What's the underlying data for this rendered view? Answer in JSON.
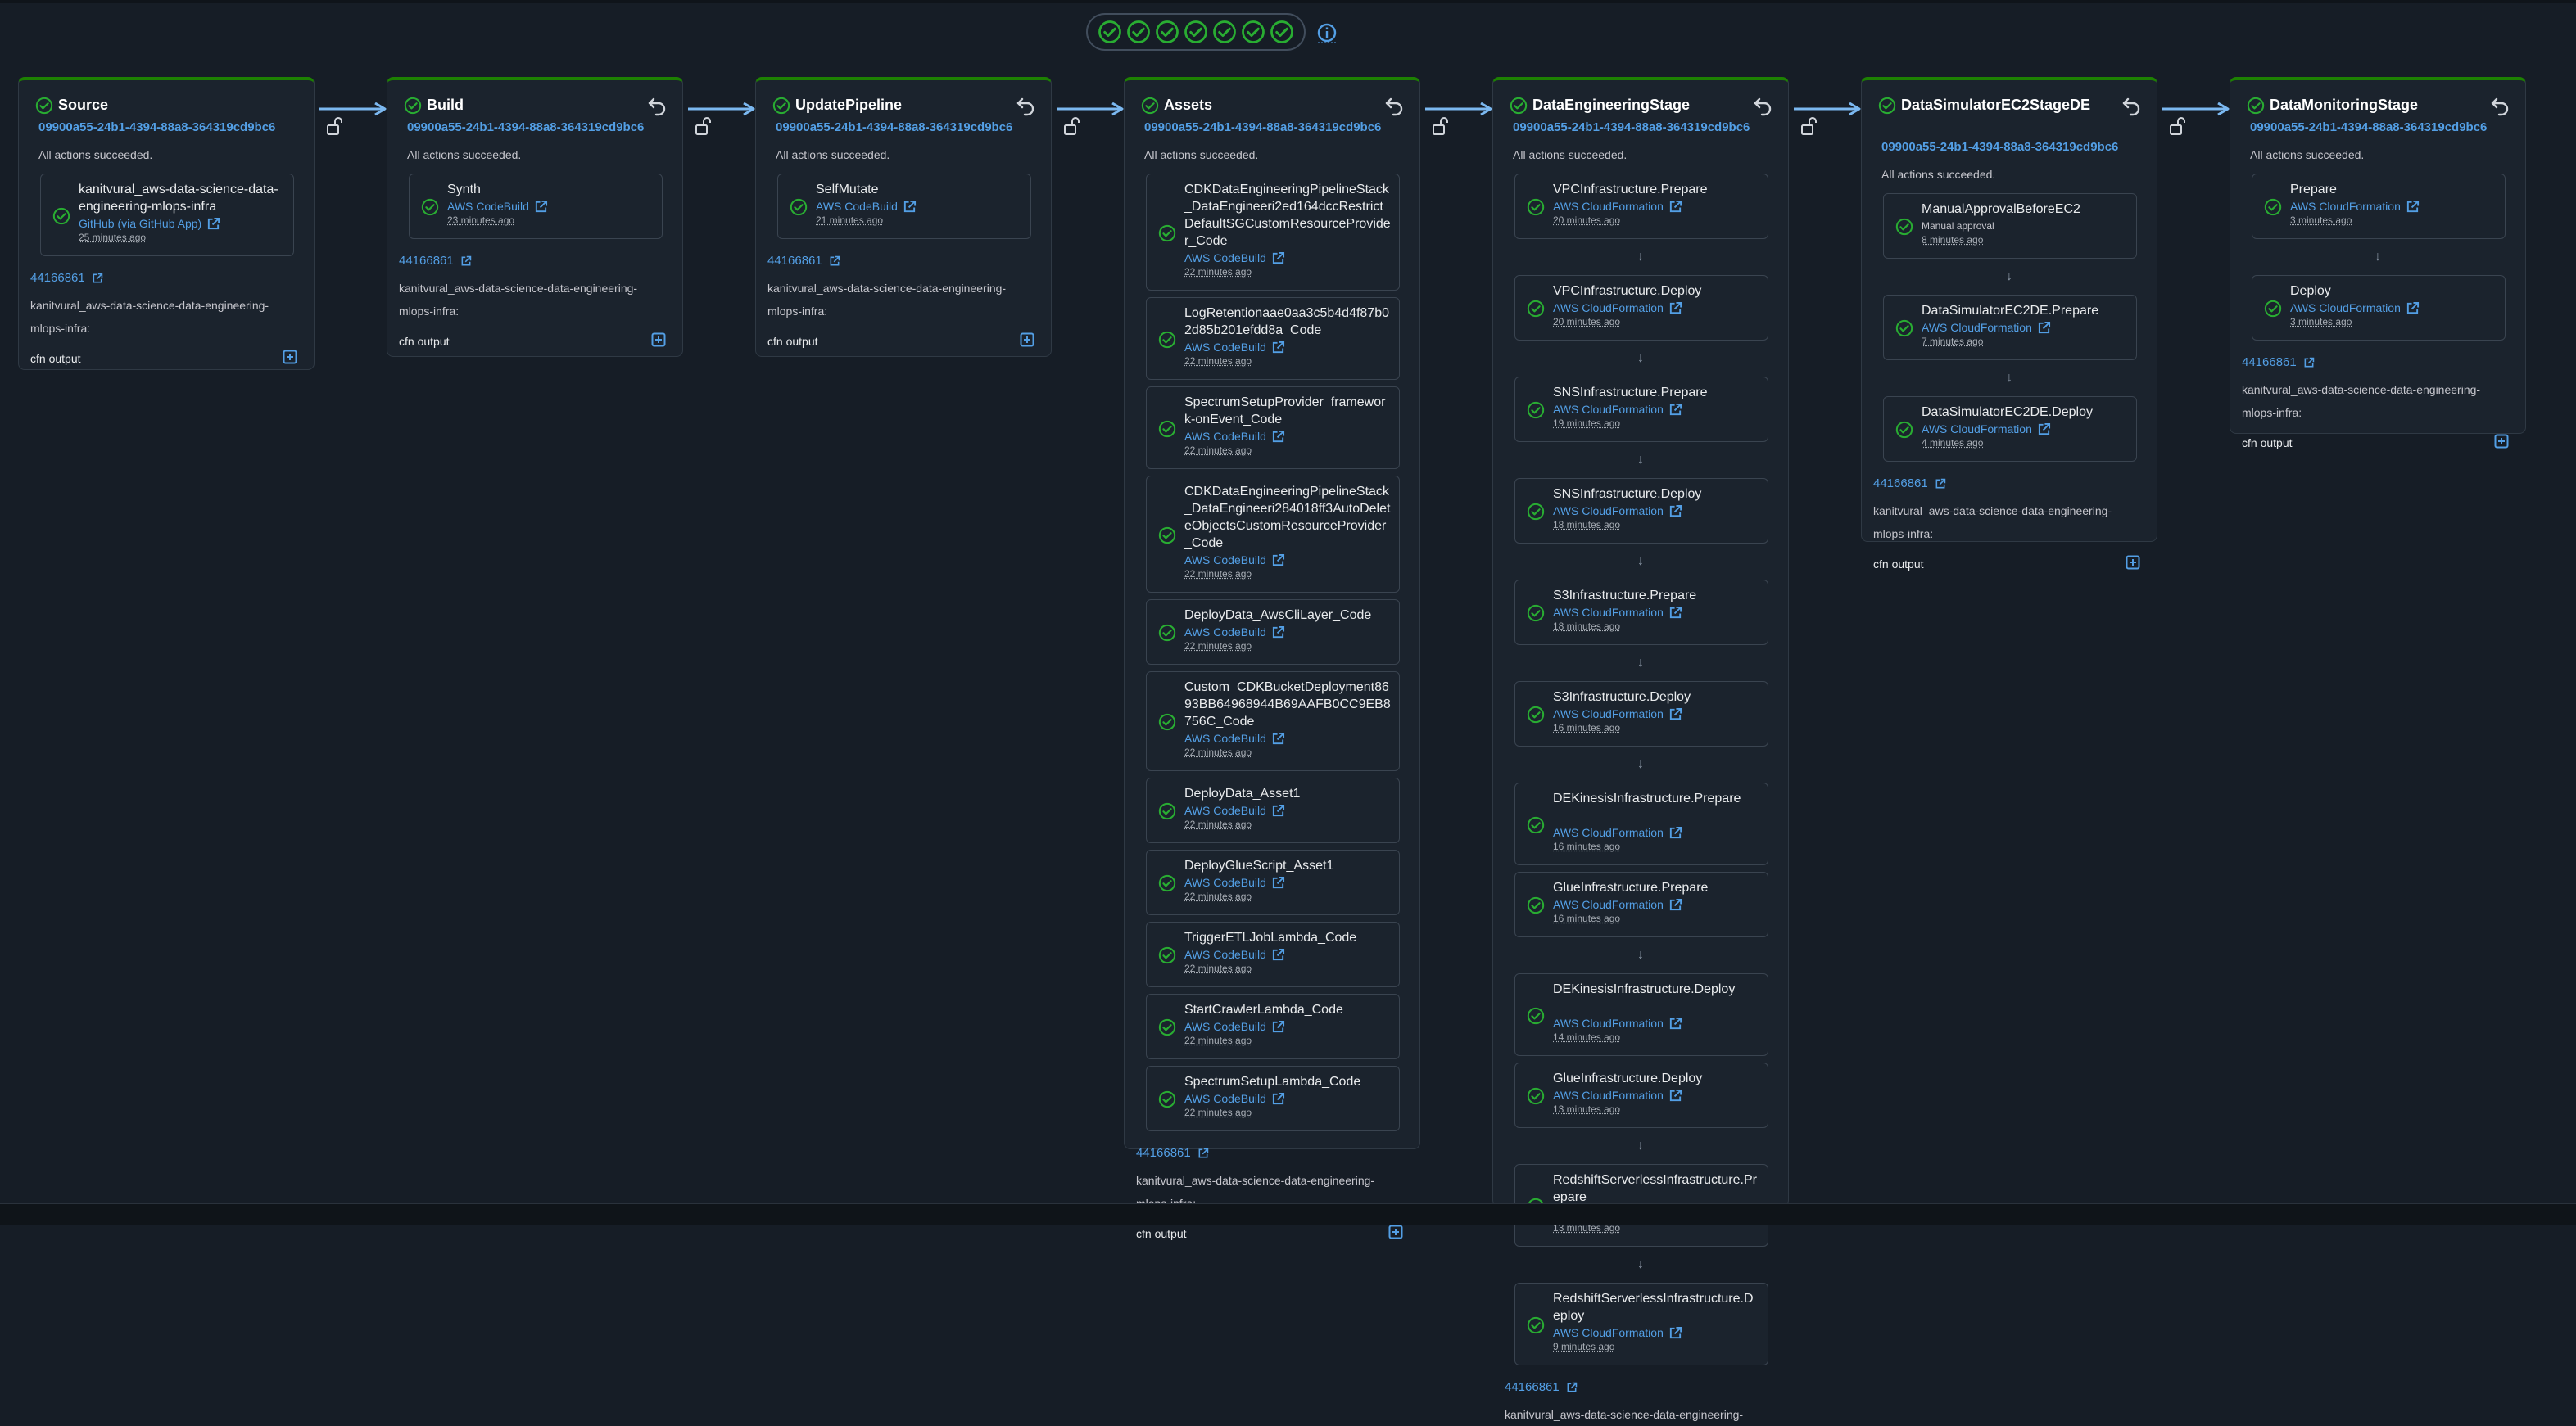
{
  "summary": {
    "stage_count": 7,
    "status": "succeeded",
    "accent": "#29ad32"
  },
  "colors": {
    "success": "#29ad32",
    "link": "#539fe5",
    "stage_border": "#1d8102",
    "background": "#161d26"
  },
  "stages": [
    {
      "title": "Source",
      "execution_id": "09900a55-24b1-4394-88a8-364319cd9bc6",
      "status": "All actions succeeded.",
      "actions": [
        {
          "name": "kanitvural_aws-data-science-data-engineering-mlops-infra",
          "provider": "GitHub (via GitHub App)",
          "time": "25 minutes ago"
        }
      ],
      "commit_id": "44166861",
      "commit_message": "kanitvural_aws-data-science-data-engineering-mlops-infra:",
      "output_label": "cfn output"
    },
    {
      "title": "Build",
      "execution_id": "09900a55-24b1-4394-88a8-364319cd9bc6",
      "status": "All actions succeeded.",
      "actions": [
        {
          "name": "Synth",
          "provider": "AWS CodeBuild",
          "time": "23 minutes ago"
        }
      ],
      "commit_id": "44166861",
      "commit_message": "kanitvural_aws-data-science-data-engineering-mlops-infra:",
      "output_label": "cfn output"
    },
    {
      "title": "UpdatePipeline",
      "execution_id": "09900a55-24b1-4394-88a8-364319cd9bc6",
      "status": "All actions succeeded.",
      "actions": [
        {
          "name": "SelfMutate",
          "provider": "AWS CodeBuild",
          "time": "21 minutes ago"
        }
      ],
      "commit_id": "44166861",
      "commit_message": "kanitvural_aws-data-science-data-engineering-mlops-infra:",
      "output_label": "cfn output"
    },
    {
      "title": "Assets",
      "execution_id": "09900a55-24b1-4394-88a8-364319cd9bc6",
      "status": "All actions succeeded.",
      "actions": [
        {
          "name": "CDKDataEngineeringPipelineStack_DataEngineeri2ed164dccRestrictDefaultSGCustomResourceProvider_Code",
          "provider": "AWS CodeBuild",
          "time": "22 minutes ago"
        },
        {
          "name": "LogRetentionaae0aa3c5b4d4f87b02d85b201efdd8a_Code",
          "provider": "AWS CodeBuild",
          "time": "22 minutes ago"
        },
        {
          "name": "SpectrumSetupProvider_framework-onEvent_Code",
          "provider": "AWS CodeBuild",
          "time": "22 minutes ago"
        },
        {
          "name": "CDKDataEngineeringPipelineStack_DataEngineeri284018ff3AutoDeleteObjectsCustomResourceProvider_Code",
          "provider": "AWS CodeBuild",
          "time": "22 minutes ago"
        },
        {
          "name": "DeployData_AwsCliLayer_Code",
          "provider": "AWS CodeBuild",
          "time": "22 minutes ago"
        },
        {
          "name": "Custom_CDKBucketDeployment8693BB64968944B69AAFB0CC9EB8756C_Code",
          "provider": "AWS CodeBuild",
          "time": "22 minutes ago"
        },
        {
          "name": "DeployData_Asset1",
          "provider": "AWS CodeBuild",
          "time": "22 minutes ago"
        },
        {
          "name": "DeployGlueScript_Asset1",
          "provider": "AWS CodeBuild",
          "time": "22 minutes ago"
        },
        {
          "name": "TriggerETLJobLambda_Code",
          "provider": "AWS CodeBuild",
          "time": "22 minutes ago"
        },
        {
          "name": "StartCrawlerLambda_Code",
          "provider": "AWS CodeBuild",
          "time": "22 minutes ago"
        },
        {
          "name": "SpectrumSetupLambda_Code",
          "provider": "AWS CodeBuild",
          "time": "22 minutes ago"
        }
      ],
      "commit_id": "44166861",
      "commit_message": "kanitvural_aws-data-science-data-engineering-mlops-infra:",
      "output_label": "cfn output"
    },
    {
      "title": "DataEngineeringStage",
      "execution_id": "09900a55-24b1-4394-88a8-364319cd9bc6",
      "status": "All actions succeeded.",
      "actions": [
        {
          "name": "VPCInfrastructure.Prepare",
          "provider": "AWS CloudFormation",
          "time": "20 minutes ago"
        },
        {
          "name": "VPCInfrastructure.Deploy",
          "provider": "AWS CloudFormation",
          "time": "20 minutes ago"
        },
        {
          "name": "SNSInfrastructure.Prepare",
          "provider": "AWS CloudFormation",
          "time": "19 minutes ago"
        },
        {
          "name": "SNSInfrastructure.Deploy",
          "provider": "AWS CloudFormation",
          "time": "18 minutes ago"
        },
        {
          "name": "S3Infrastructure.Prepare",
          "provider": "AWS CloudFormation",
          "time": "18 minutes ago"
        },
        {
          "name": "S3Infrastructure.Deploy",
          "provider": "AWS CloudFormation",
          "time": "16 minutes ago"
        },
        {
          "name": "DEKinesisInfrastructure.Prepare",
          "provider": "AWS CloudFormation",
          "time": "16 minutes ago"
        },
        {
          "name": "GlueInfrastructure.Prepare",
          "provider": "AWS CloudFormation",
          "time": "16 minutes ago"
        },
        {
          "name": "DEKinesisInfrastructure.Deploy",
          "provider": "AWS CloudFormation",
          "time": "14 minutes ago"
        },
        {
          "name": "GlueInfrastructure.Deploy",
          "provider": "AWS CloudFormation",
          "time": "13 minutes ago"
        },
        {
          "name": "RedshiftServerlessInfrastructure.Prepare",
          "provider": "AWS CloudFormation",
          "time": "13 minutes ago"
        },
        {
          "name": "RedshiftServerlessInfrastructure.Deploy",
          "provider": "AWS CloudFormation",
          "time": "9 minutes ago"
        }
      ],
      "commit_id": "44166861",
      "commit_message": "kanitvural_aws-data-science-data-engineering-"
    },
    {
      "title": "DataSimulatorEC2StageDE",
      "execution_id": "09900a55-24b1-4394-88a8-364319cd9bc6",
      "status": "All actions succeeded.",
      "actions": [
        {
          "name": "ManualApprovalBeforeEC2",
          "provider": "Manual approval",
          "time": "8 minutes ago"
        },
        {
          "name": "DataSimulatorEC2DE.Prepare",
          "provider": "AWS CloudFormation",
          "time": "7 minutes ago"
        },
        {
          "name": "DataSimulatorEC2DE.Deploy",
          "provider": "AWS CloudFormation",
          "time": "4 minutes ago"
        }
      ],
      "commit_id": "44166861",
      "commit_message": "kanitvural_aws-data-science-data-engineering-mlops-infra:",
      "output_label": "cfn output"
    },
    {
      "title": "DataMonitoringStage",
      "execution_id": "09900a55-24b1-4394-88a8-364319cd9bc6",
      "status": "All actions succeeded.",
      "actions": [
        {
          "name": "Prepare",
          "provider": "AWS CloudFormation",
          "time": "3 minutes ago"
        },
        {
          "name": "Deploy",
          "provider": "AWS CloudFormation",
          "time": "3 minutes ago"
        }
      ],
      "commit_id": "44166861",
      "commit_message": "kanitvural_aws-data-science-data-engineering-mlops-infra:",
      "output_label": "cfn output"
    }
  ]
}
